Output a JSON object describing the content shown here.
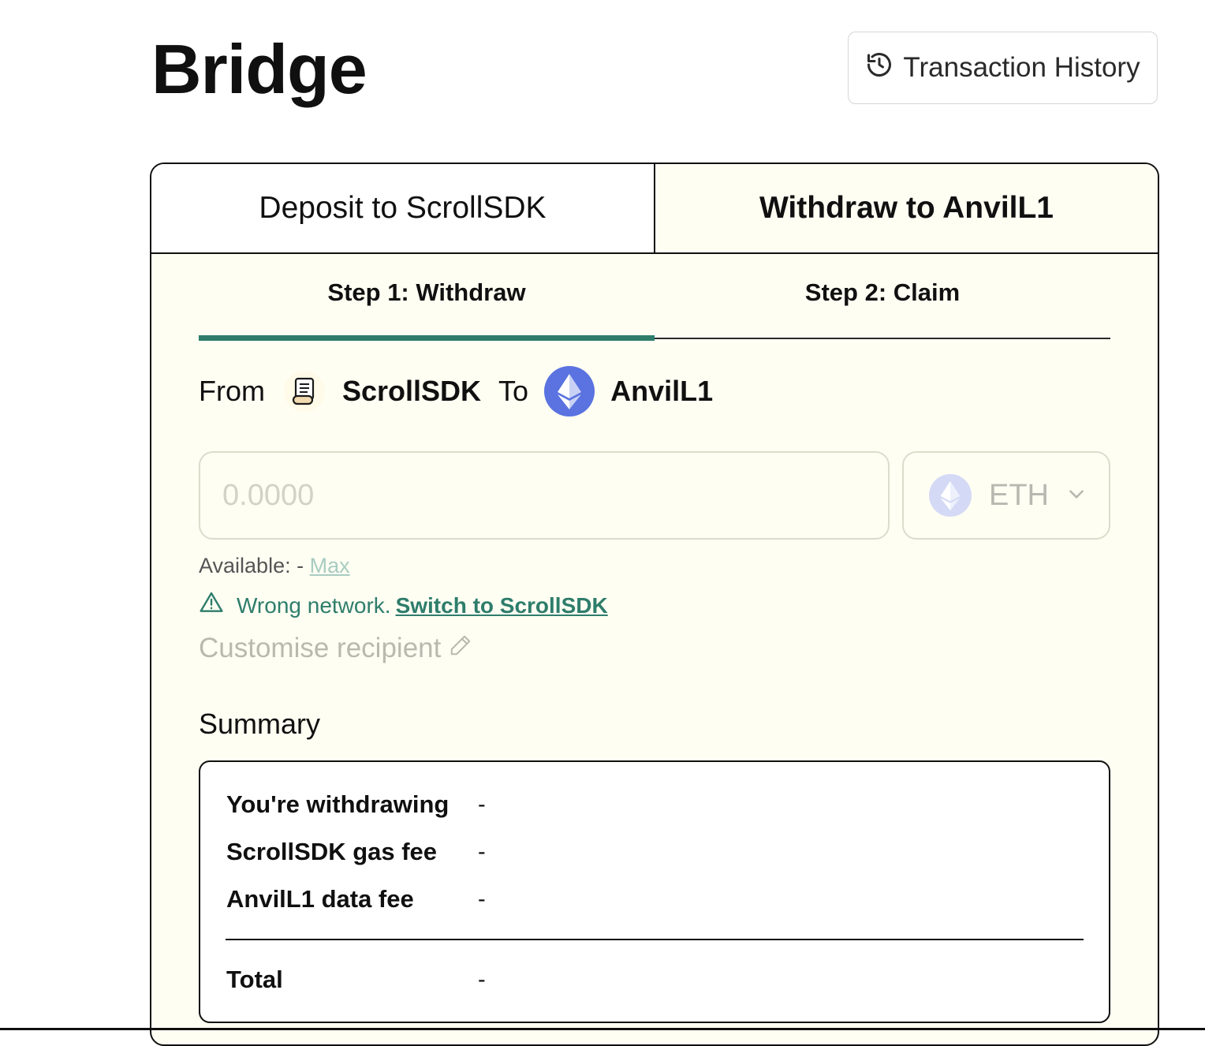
{
  "page": {
    "title": "Bridge"
  },
  "header": {
    "history_label": "Transaction History"
  },
  "main_tabs": [
    {
      "label": "Deposit to ScrollSDK"
    },
    {
      "label": "Withdraw to AnvilL1"
    }
  ],
  "step_tabs": [
    {
      "label": "Step 1: Withdraw"
    },
    {
      "label": "Step 2: Claim"
    }
  ],
  "route": {
    "from_label": "From",
    "from_network": "ScrollSDK",
    "to_label": "To",
    "to_network": "AnvilL1",
    "from_icon": "scroll-icon",
    "to_icon": "ethereum-icon"
  },
  "amount": {
    "placeholder": "0.0000",
    "value": ""
  },
  "token": {
    "symbol": "ETH",
    "icon": "ethereum-icon"
  },
  "available": {
    "label": "Available:",
    "value": "-",
    "max_label": "Max"
  },
  "warning": {
    "text": "Wrong network.",
    "link": "Switch to ScrollSDK"
  },
  "recipient": {
    "label": "Customise recipient"
  },
  "summary": {
    "title": "Summary",
    "rows": [
      {
        "label": "You're withdrawing",
        "value": "-"
      },
      {
        "label": "ScrollSDK gas fee",
        "value": "-"
      },
      {
        "label": "AnvilL1 data fee",
        "value": "-"
      }
    ],
    "total": {
      "label": "Total",
      "value": "-"
    }
  },
  "colors": {
    "accent": "#2e7d6b",
    "card_background": "#fefef3",
    "ethereum": "#5a73e0"
  }
}
